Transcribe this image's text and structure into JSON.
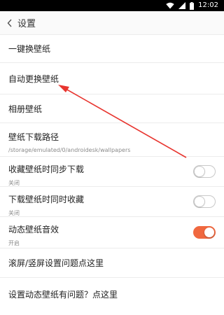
{
  "status_bar": {
    "time": "12:02"
  },
  "app_bar": {
    "title": "设置"
  },
  "settings": {
    "item1": {
      "label": "一键换壁纸"
    },
    "item2": {
      "label": "自动更换壁纸"
    },
    "item3": {
      "label": "相册壁纸"
    },
    "item4": {
      "label": "壁纸下载路径",
      "value": "/storage/emulated/0/androidesk/wallpapers"
    },
    "item5": {
      "label": "收藏壁纸时同步下载",
      "state": "关闭",
      "enabled": false
    },
    "item6": {
      "label": "下载壁纸时同时收藏",
      "state": "关闭",
      "enabled": false
    },
    "item7": {
      "label": "动态壁纸音效",
      "state": "开启",
      "enabled": true
    },
    "item8": {
      "label": "滚屏/竖屏设置问题点这里"
    },
    "item9": {
      "label": "设置动态壁纸有问题？点这里"
    }
  },
  "colors": {
    "accent": "#f0683f",
    "annotation": "#e8352f"
  }
}
